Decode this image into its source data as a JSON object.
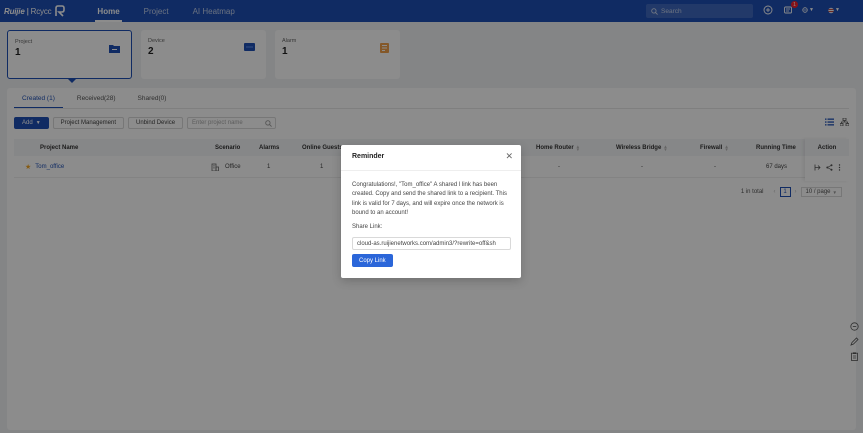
{
  "header": {
    "logo_brand": "Ruijie",
    "logo_sep": "|",
    "logo_sub": "Rcycc",
    "nav": [
      "Home",
      "Project",
      "AI Heatmap"
    ],
    "search_placeholder": "Search",
    "notification_count": "1"
  },
  "cards": [
    {
      "label": "Project",
      "value": "1",
      "icon": "folder-icon",
      "color": "#1e4fb4"
    },
    {
      "label": "Device",
      "value": "2",
      "icon": "device-icon",
      "color": "#1e4fb4"
    },
    {
      "label": "Alarm",
      "value": "1",
      "icon": "alarm-icon",
      "color": "#f0a04b"
    }
  ],
  "tabs": [
    "Created (1)",
    "Received(28)",
    "Shared(0)"
  ],
  "toolbar": {
    "add_label": "Add",
    "project_management": "Project Management",
    "unbind_device": "Unbind Device",
    "project_name_placeholder": "Enter project name"
  },
  "table": {
    "columns": [
      "Project Name",
      "Scenario",
      "Alarms",
      "Online Guests",
      "Home Router",
      "Wireless Bridge",
      "Firewall",
      "Running Time",
      "Action"
    ],
    "rows": [
      {
        "project_name": "Tom_office",
        "scenario": "Office",
        "alarms": "1",
        "online_guests": "1",
        "home_router": "-",
        "wireless_bridge": "-",
        "firewall": "-",
        "running_time": "67 days"
      }
    ]
  },
  "pagination": {
    "total": "1 in total",
    "current_page": "1",
    "page_size": "10 / page"
  },
  "modal": {
    "title": "Reminder",
    "message": "Congratulations!, \"Tom_office\" A shared l link has been created. Copy and send the shared link to a recipient. This link is valid for 7 days, and will expire once the network is bound to an account!",
    "share_link_label": "Share Link:",
    "share_link_value": "cloud-as.ruijienetworks.com/admin3/?rewrite=off&sh",
    "copy_button": "Copy Link"
  },
  "colors": {
    "brand": "#1e4fb4",
    "star": "#f5a623"
  }
}
